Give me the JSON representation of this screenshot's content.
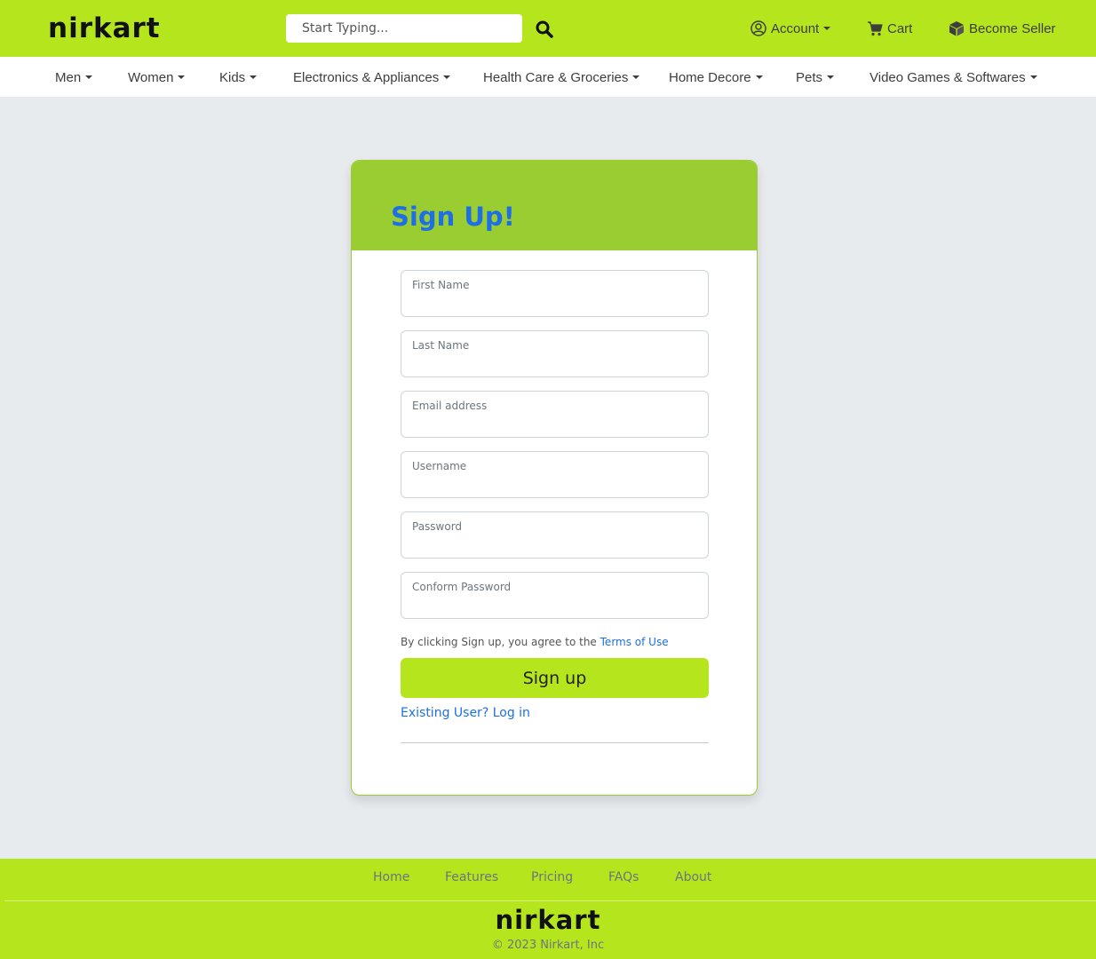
{
  "header": {
    "logo": "nirkart",
    "search_placeholder": "Start Typing...",
    "account_label": "Account",
    "cart_label": "Cart",
    "seller_label": "Become Seller",
    "icons": {
      "search": "search-icon",
      "account": "user-circle-icon",
      "cart": "cart-icon",
      "seller": "box-icon"
    }
  },
  "categories": [
    "Men",
    "Women",
    "Kids",
    "Electronics & Appliances",
    "Health Care & Groceries",
    "Home Decore",
    "Pets",
    "Video Games & Softwares"
  ],
  "signup": {
    "title": "Sign Up!",
    "fields": [
      {
        "label": "First Name",
        "value": ""
      },
      {
        "label": "Last Name",
        "value": ""
      },
      {
        "label": "Email address",
        "value": ""
      },
      {
        "label": "Username",
        "value": ""
      },
      {
        "label": "Password",
        "value": ""
      },
      {
        "label": "Conform Password",
        "value": ""
      }
    ],
    "terms_text": "By clicking Sign up, you agree to the",
    "terms_link": "Terms of Use",
    "button_label": "Sign up",
    "login_link": "Existing User? Log in"
  },
  "footer": {
    "links": [
      "Home",
      "Features",
      "Pricing",
      "FAQs",
      "About"
    ],
    "logo": "nirkart",
    "copyright": "© 2023 Nirkart, Inc"
  },
  "colors": {
    "brand_green": "#b5e61d",
    "card_header_green": "#9acd32",
    "link_blue": "#1e6fe6",
    "page_bg": "#e8ebee"
  }
}
